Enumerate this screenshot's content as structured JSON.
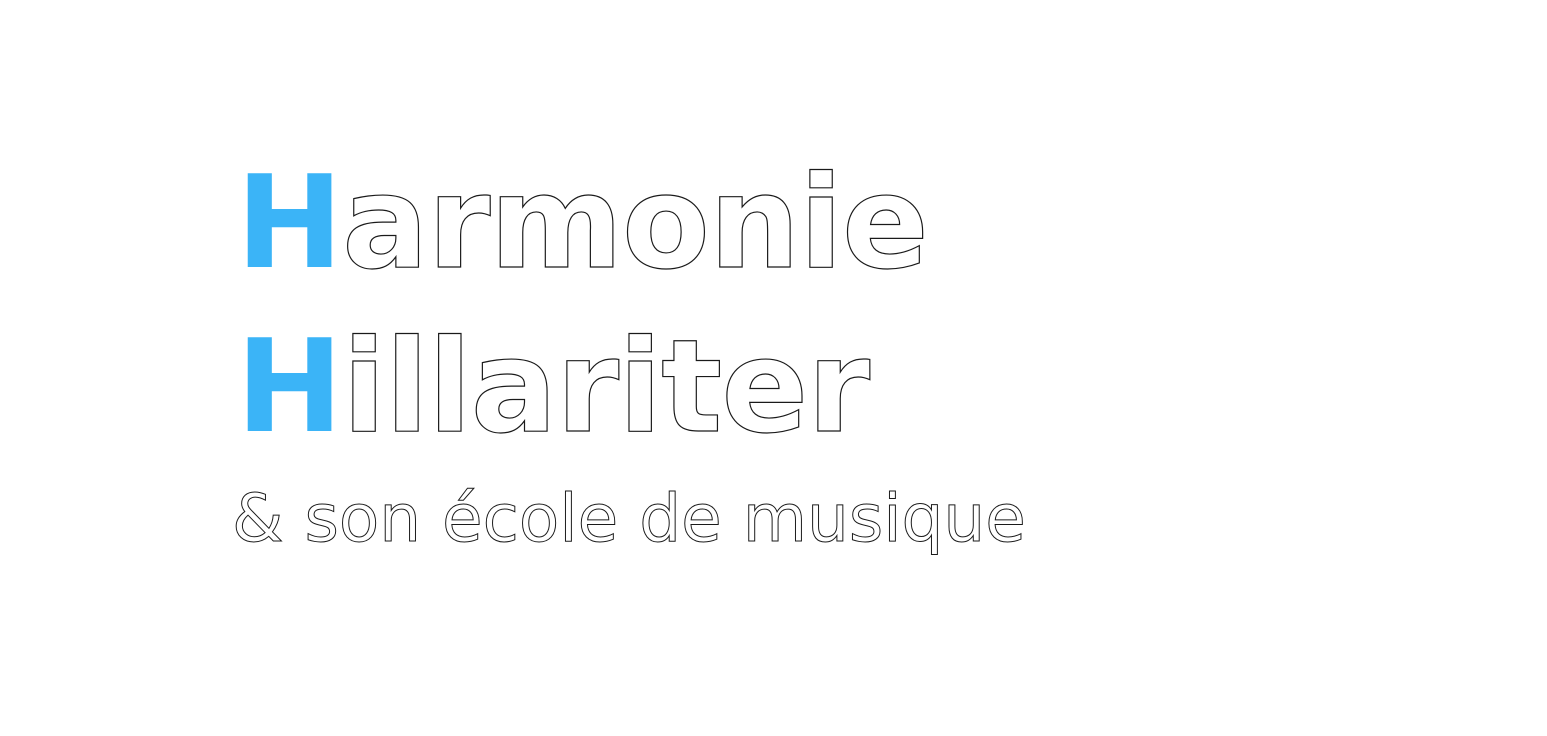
{
  "logo": {
    "line1": {
      "initial": "H",
      "rest": "armonie"
    },
    "line2": {
      "initial": "H",
      "rest": "illariter"
    },
    "tagline": "& son école de musique"
  },
  "colors": {
    "accent": "#3bb4f7",
    "background": "#ffffff",
    "text_fill": "#ffffff",
    "outline": "#1a1a1a"
  }
}
